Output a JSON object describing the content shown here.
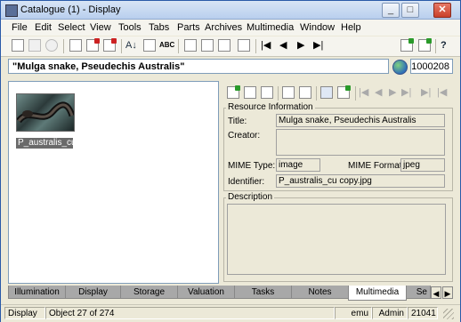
{
  "window": {
    "title": "Catalogue (1) - Display",
    "controls": {
      "minimize": "_",
      "maximize": "□",
      "close": "✕"
    }
  },
  "menu": [
    "File",
    "Edit",
    "Select",
    "View",
    "Tools",
    "Tabs",
    "Parts",
    "Archives",
    "Multimedia",
    "Window",
    "Help"
  ],
  "toolbar": {
    "icons": [
      "new-doc-icon",
      "save-icon",
      "cancel-icon",
      "copy-record-icon",
      "duplicate-record-icon",
      "delete-record-icon",
      "sort-icon",
      "edit-icon",
      "spellcheck-icon",
      "report-icon",
      "grid-view-icon",
      "list-view-icon",
      "form-view-icon",
      "first-record-icon",
      "prev-record-icon",
      "next-record-icon",
      "last-record-icon",
      "export-icon",
      "import-icon",
      "context-help-icon"
    ],
    "glyphs": {
      "sort": "A↓",
      "spell": "ABC",
      "first": "|◀",
      "prev": "◀",
      "next": "▶",
      "last": "▶|",
      "help": "?"
    }
  },
  "record": {
    "title": "\"Mulga snake, Pseudechis Australis\"",
    "number": "1000208"
  },
  "thumbnail": {
    "caption": "P_australis_cu"
  },
  "multimedia_toolbar": {
    "nav": {
      "first": "|◀",
      "prev": "◀",
      "next": "▶",
      "last": "▶|",
      "end": "▶|",
      "begin": "|◀"
    }
  },
  "resource": {
    "heading": "Resource Information",
    "title_label": "Title:",
    "title_value": "Mulga snake, Pseudechis Australis",
    "creator_label": "Creator:",
    "creator_value": "",
    "mime_type_label": "MIME Type:",
    "mime_type_value": "image",
    "mime_format_label": "MIME Format:",
    "mime_format_value": "jpeg",
    "identifier_label": "Identifier:",
    "identifier_value": "P_australis_cu copy.jpg",
    "description_heading": "Description",
    "description_value": ""
  },
  "tabs": [
    {
      "label": "Illumination",
      "active": false
    },
    {
      "label": "Display",
      "active": false
    },
    {
      "label": "Storage",
      "active": false
    },
    {
      "label": "Valuation",
      "active": false
    },
    {
      "label": "Tasks",
      "active": false
    },
    {
      "label": "Notes",
      "active": false
    },
    {
      "label": "Multimedia",
      "active": true
    },
    {
      "label": "Se",
      "active": false
    }
  ],
  "tab_scroll": {
    "left": "◀",
    "right": "▶"
  },
  "status": {
    "mode": "Display",
    "position": "Object 27 of 274",
    "user": "emu",
    "role": "Admin",
    "count": "21041"
  },
  "colors": {
    "window_border": "#2a5aa8",
    "panel_border": "#7f9db9",
    "face": "#ece9d8"
  }
}
